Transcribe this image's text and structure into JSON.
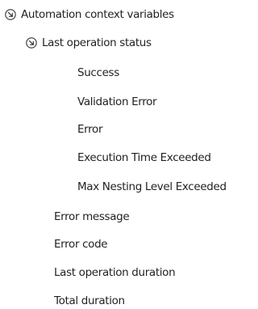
{
  "tree": {
    "root": {
      "label": "Automation context variables",
      "icon": "collapse-arrow-icon",
      "expanded": true
    },
    "last_operation_status": {
      "label": "Last operation status",
      "icon": "collapse-arrow-icon",
      "expanded": true,
      "children": [
        "Success",
        "Validation Error",
        "Error",
        "Execution Time Exceeded",
        "Max Nesting Level Exceeded"
      ]
    },
    "items": [
      "Error message",
      "Error code",
      "Last operation duration",
      "Total duration"
    ]
  },
  "colors": {
    "text": "#222222",
    "icon": "#333333",
    "background": "#ffffff"
  }
}
